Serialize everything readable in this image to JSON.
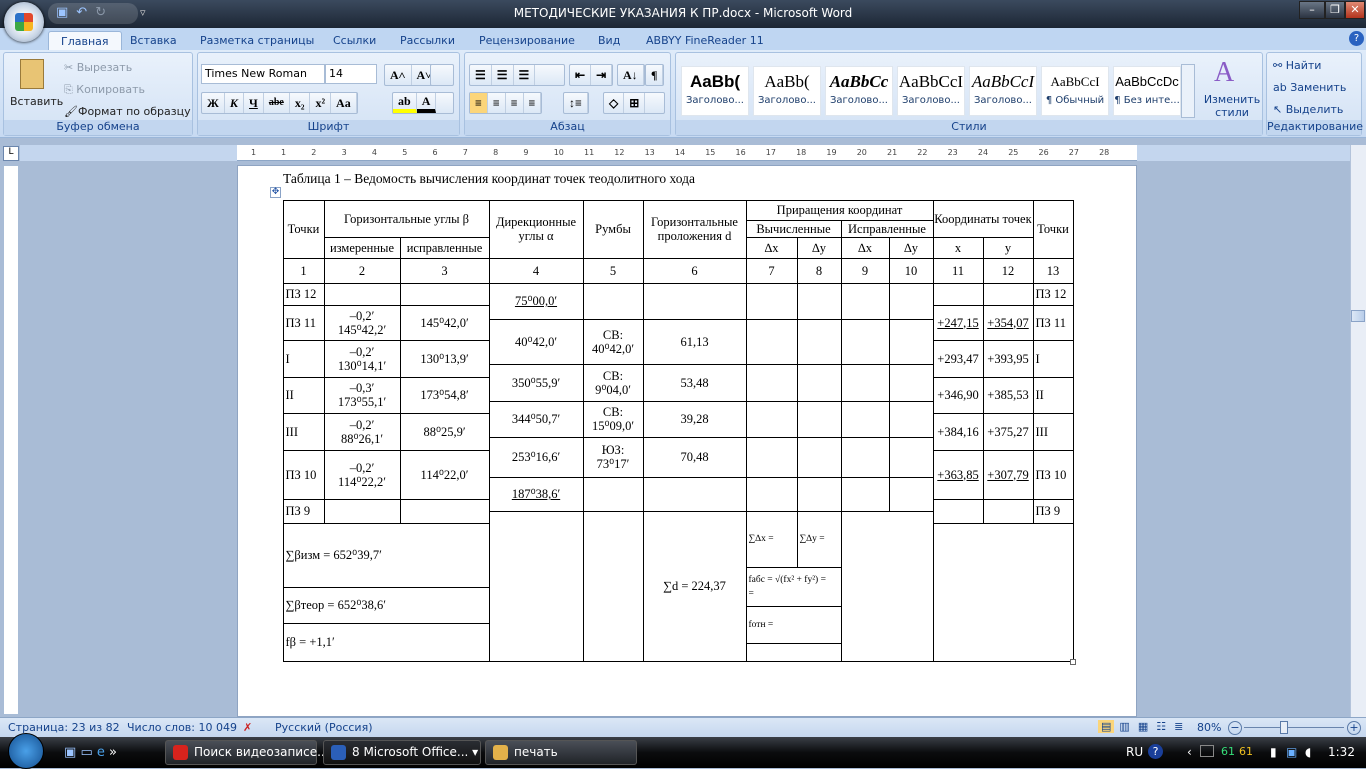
{
  "window": {
    "title": "МЕТОДИЧЕСКИЕ УКАЗАНИЯ К ПР.docx - Microsoft Word"
  },
  "tabs": [
    {
      "label": "Главная",
      "active": true
    },
    {
      "label": "Вставка"
    },
    {
      "label": "Разметка страницы"
    },
    {
      "label": "Ссылки"
    },
    {
      "label": "Рассылки"
    },
    {
      "label": "Рецензирование"
    },
    {
      "label": "Вид"
    },
    {
      "label": "ABBYY FineReader 11"
    }
  ],
  "ribbon": {
    "clipboard": {
      "label": "Буфер обмена",
      "paste": "Вставить",
      "cut": "Вырезать",
      "copy": "Копировать",
      "format_painter": "Формат по образцу"
    },
    "font": {
      "label": "Шрифт",
      "font_name": "Times New Roman",
      "font_size": "14",
      "bold": "Ж",
      "italic": "К",
      "underline": "Ч",
      "strike": "abe",
      "sub": "x₂",
      "sup": "x²",
      "case": "Aa"
    },
    "paragraph": {
      "label": "Абзац"
    },
    "styles": {
      "label": "Стили",
      "change": "Изменить стили",
      "items": [
        {
          "sample": "AaBb(",
          "name": "Заголово..."
        },
        {
          "sample": "AaBb(",
          "name": "Заголово..."
        },
        {
          "sample": "AaBbCc",
          "name": "Заголово..."
        },
        {
          "sample": "AaBbCcI",
          "name": "Заголово..."
        },
        {
          "sample": "AaBbCcI",
          "name": "Заголово..."
        },
        {
          "sample": "AaBbCcI",
          "name": "¶ Обычный"
        },
        {
          "sample": "AaBbCcDc",
          "name": "¶ Без инте..."
        }
      ]
    },
    "editing": {
      "label": "Редактирование",
      "find": "Найти",
      "replace": "Заменить",
      "select": "Выделить"
    }
  },
  "ruler": {
    "marks": [
      "1",
      "1",
      "2",
      "3",
      "4",
      "5",
      "6",
      "7",
      "8",
      "9",
      "10",
      "11",
      "12",
      "13",
      "14",
      "15",
      "16",
      "17",
      "18",
      "19",
      "20",
      "21",
      "22",
      "23",
      "24",
      "25",
      "26",
      "27",
      "28"
    ]
  },
  "document": {
    "caption": "Таблица 1 – Ведомость вычисления координат точек теодолитного хода",
    "table": {
      "header": {
        "points": "Точки",
        "hor_angles": "Горизонтальные углы β",
        "measured": "измеренные",
        "corrected": "исправленные",
        "dir_angles": "Дирекционные углы α",
        "bearings": "Румбы",
        "distances": "Горизонтальные проложения d",
        "increments": "Приращения координат",
        "computed": "Вычисленные",
        "corrected_inc": "Исправленные",
        "dx": "∆x",
        "dy": "∆y",
        "coords": "Координаты точек",
        "x": "x",
        "y": "y",
        "points_right": "Точки"
      },
      "column_numbers": [
        "1",
        "2",
        "3",
        "4",
        "5",
        "6",
        "7",
        "8",
        "9",
        "10",
        "11",
        "12",
        "13"
      ],
      "stations": [
        {
          "point": "ПЗ 12",
          "measured": "",
          "corrected": "",
          "x": "",
          "y": ""
        },
        {
          "point": "ПЗ 11",
          "measured": "–0,2ʹ\n145⁰42,2ʹ",
          "corrected": "145⁰42,0ʹ",
          "x": "+247,15",
          "y": "+354,07"
        },
        {
          "point": "I",
          "measured": "–0,2ʹ\n130⁰14,1ʹ",
          "corrected": "130⁰13,9ʹ",
          "x": "+293,47",
          "y": "+393,95"
        },
        {
          "point": "II",
          "measured": "–0,3ʹ\n173⁰55,1ʹ",
          "corrected": "173⁰54,8ʹ",
          "x": "+346,90",
          "y": "+385,53"
        },
        {
          "point": "III",
          "measured": "–0,2ʹ\n88⁰26,1ʹ",
          "corrected": "88⁰25,9ʹ",
          "x": "+384,16",
          "y": "+375,27"
        },
        {
          "point": "ПЗ 10",
          "measured": "–0,2ʹ\n114⁰22,2ʹ",
          "corrected": "114⁰22,0ʹ",
          "x": "+363,85",
          "y": "+307,79"
        },
        {
          "point": "ПЗ 9",
          "measured": "",
          "corrected": "",
          "x": "",
          "y": ""
        }
      ],
      "lines": [
        {
          "dir": "75⁰00,0ʹ",
          "bearing": "",
          "d": ""
        },
        {
          "dir": "40⁰42,0ʹ",
          "bearing": "СВ:\n40⁰42,0ʹ",
          "d": "61,13"
        },
        {
          "dir": "350⁰55,9ʹ",
          "bearing": "СВ:\n9⁰04,0ʹ",
          "d": "53,48"
        },
        {
          "dir": "344⁰50,7ʹ",
          "bearing": "СВ:\n15⁰09,0ʹ",
          "d": "39,28"
        },
        {
          "dir": "253⁰16,6ʹ",
          "bearing": "ЮЗ:\n73⁰17ʹ",
          "d": "70,48"
        },
        {
          "dir": "187⁰38,6ʹ",
          "bearing": "",
          "d": ""
        }
      ],
      "totals": {
        "sum_beta_measured": "∑βизм = 652⁰39,7ʹ",
        "sum_beta_theor": "∑βтеор = 652⁰38,6ʹ",
        "f_beta": "fβ = +1,1ʹ",
        "sum_d": "∑d = 224,37",
        "sum_dx": "∑∆x =",
        "sum_dy": "∑∆y =",
        "f_abs": "fабс = √(fx² + fy²) =\n=",
        "f_rel": "fотн ="
      }
    }
  },
  "status": {
    "page": "Страница: 23 из 82",
    "words": "Число слов: 10 049",
    "language": "Русский (Россия)",
    "zoom": "80%",
    "zoom_percent": 80
  },
  "taskbar": {
    "items": [
      {
        "label": "Поиск видеозаписе...",
        "color": "#d8231d"
      },
      {
        "label": "8 Microsoft Office...",
        "color": "#2b5fb8"
      },
      {
        "label": "печать",
        "color": "#e3b14a"
      }
    ],
    "lang": "RU",
    "tray_num1": "61",
    "tray_num2": "61",
    "clock": "1:32"
  }
}
